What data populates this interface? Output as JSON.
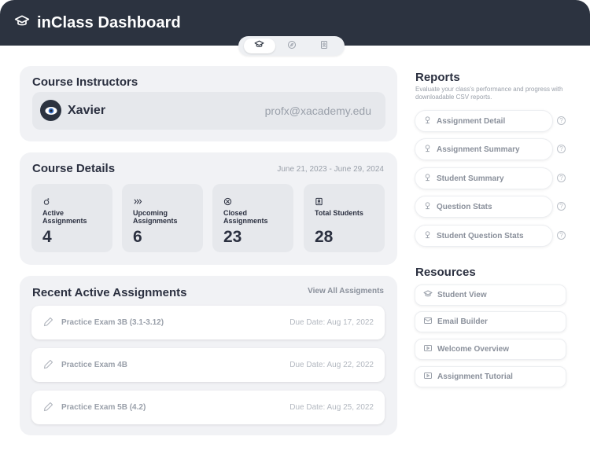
{
  "header": {
    "title": "inClass Dashboard"
  },
  "tabs": [
    {
      "icon": "graduation-cap-icon",
      "active": true
    },
    {
      "icon": "compass-icon",
      "active": false
    },
    {
      "icon": "id-card-icon",
      "active": false
    }
  ],
  "instructors": {
    "title": "Course Instructors",
    "name": "Xavier",
    "email": "profx@xacademy.edu"
  },
  "details": {
    "title": "Course Details",
    "date_range": "June 21, 2023 - June 29, 2024",
    "stats": [
      {
        "label": "Active Assignments",
        "value": "4",
        "icon": "sparkle-icon"
      },
      {
        "label": "Upcoming Assignments",
        "value": "6",
        "icon": "fast-forward-icon"
      },
      {
        "label": "Closed Assignments",
        "value": "23",
        "icon": "closed-icon"
      },
      {
        "label": "Total Students",
        "value": "28",
        "icon": "student-badge-icon"
      }
    ]
  },
  "recent": {
    "title": "Recent Active Assignments",
    "view_all": "View All Assigments",
    "items": [
      {
        "name": "Practice Exam 3B (3.1-3.12)",
        "due": "Due Date: Aug 17, 2022"
      },
      {
        "name": "Practice Exam 4B",
        "due": "Due Date: Aug 22, 2022"
      },
      {
        "name": "Practice Exam 5B (4.2)",
        "due": "Due Date: Aug 25, 2022"
      }
    ]
  },
  "reports": {
    "title": "Reports",
    "description": "Evaluate your class's performance and progress with downloadable CSV reports.",
    "items": [
      {
        "label": "Assignment Detail",
        "help": "?"
      },
      {
        "label": "Assignment Summary",
        "help": "?"
      },
      {
        "label": "Student Summary",
        "help": "?"
      },
      {
        "label": "Question Stats",
        "help": "?"
      },
      {
        "label": "Student Question Stats",
        "help": "?"
      }
    ]
  },
  "resources": {
    "title": "Resources",
    "items": [
      {
        "label": "Student View",
        "icon": "graduation-cap-icon"
      },
      {
        "label": "Email Builder",
        "icon": "mail-icon"
      },
      {
        "label": "Welcome Overview",
        "icon": "video-icon"
      },
      {
        "label": "Assignment Tutorial",
        "icon": "video-icon"
      }
    ]
  },
  "colors": {
    "header": "#2c3340",
    "card": "#f1f2f5",
    "tile": "#e6e8ec",
    "muted": "#9aa0aa"
  }
}
